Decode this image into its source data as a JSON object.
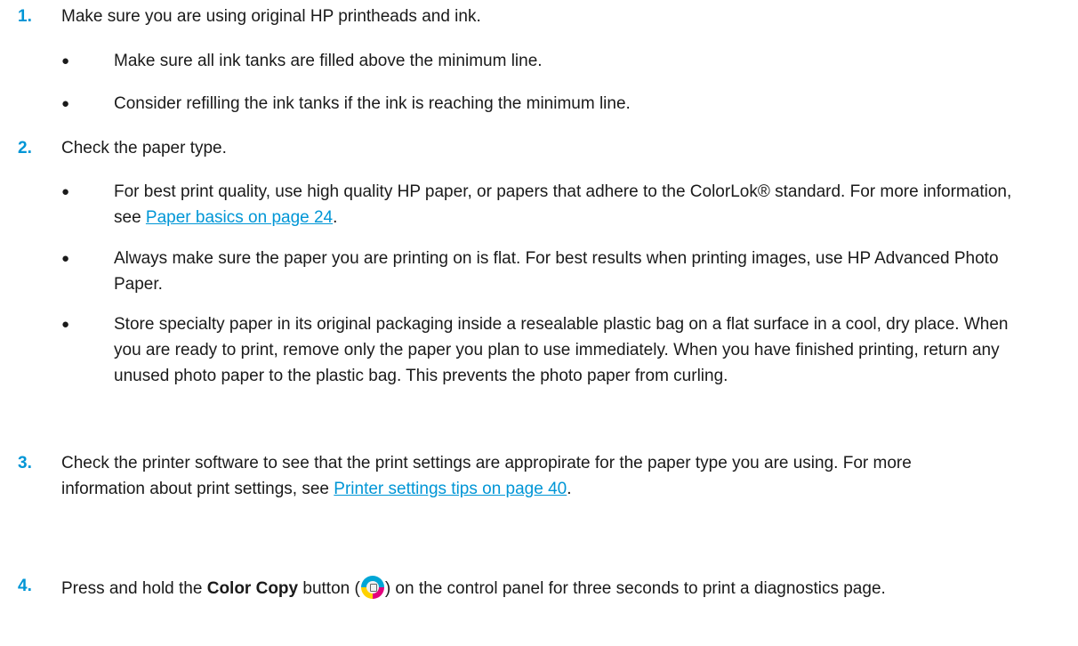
{
  "steps": [
    {
      "number": "1.",
      "text": "Make sure you are using original HP printheads and ink.",
      "bullets": [
        "Make sure all ink tanks are filled above the minimum line.",
        "Consider refilling the ink tanks if the ink is reaching the minimum line."
      ]
    },
    {
      "number": "2.",
      "text": "Check the paper type.",
      "bullets": [
        {
          "text": "For best print quality, use high quality HP paper, or papers that adhere to the ColorLok® standard. For more information, see ",
          "link": "Paper basics on page 24",
          "after": "."
        },
        "Always make sure the paper you are printing on is flat. For best results when printing images, use HP Advanced Photo Paper.",
        "Store specialty paper in its original packaging inside a resealable plastic bag on a flat surface in a cool, dry place. When you are ready to print, remove only the paper you plan to use immediately. When you have finished printing, return any unused photo paper to the plastic bag. This prevents the photo paper from curling."
      ]
    },
    {
      "number": "3.",
      "text": "Check the printer software to see that the print settings are appropirate for the paper type you are using. For more information about print settings, see ",
      "link": "Printer settings tips on page 40",
      "after": "."
    },
    {
      "number": "4.",
      "text_before": "Press and hold the ",
      "bold": "Color Copy",
      "text_mid": " button (",
      "icon": "color-copy-icon",
      "text_after": ") on the control panel for three seconds to print a diagnostics page."
    }
  ],
  "bullet_char": "●",
  "colors": {
    "accent": "#0096d6",
    "text": "#1a1a1a"
  }
}
